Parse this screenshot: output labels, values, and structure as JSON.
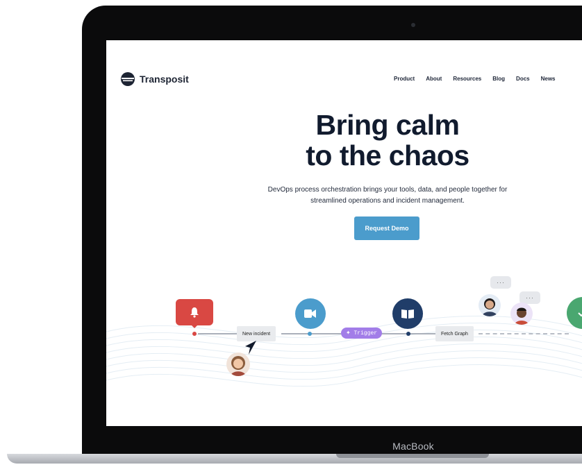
{
  "device": {
    "brand": "MacBook"
  },
  "site": {
    "name": "Transposit"
  },
  "nav": {
    "items": [
      "Product",
      "About",
      "Resources",
      "Blog",
      "Docs",
      "News"
    ]
  },
  "hero": {
    "title_line1": "Bring calm",
    "title_line2": "to the chaos",
    "subtitle_line1": "DevOps process orchestration brings your tools, data, and people together for",
    "subtitle_line2": "streamlined operations and incident management.",
    "cta_label": "Request Demo"
  },
  "workflow": {
    "steps": [
      "New incident",
      "✦ Trigger",
      "Fetch Graph"
    ],
    "typing_indicator": "···",
    "colors": {
      "alert": "#d94843",
      "slack": "#4b9ccc",
      "book": "#203d69",
      "trigger": "#a27de8",
      "success": "#4aa770"
    }
  },
  "colors": {
    "primary": "#4b9ccc",
    "text": "#111b2e"
  }
}
